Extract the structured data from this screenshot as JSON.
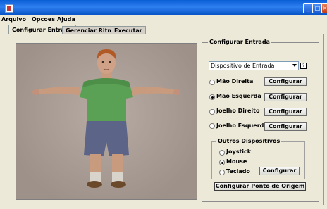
{
  "window": {
    "title": ""
  },
  "menu": [
    "Arquivo",
    "Opcoes",
    "Ajuda"
  ],
  "tabs": [
    "Configurar Entrada",
    "Gerenciar Ritmo",
    "Executar"
  ],
  "config": {
    "group_title": "Configurar Entrada",
    "device_select": "Dispositivo de Entrada",
    "help_label": "?",
    "options": [
      {
        "label": "Mão Direita",
        "selected": false,
        "button": "Configurar"
      },
      {
        "label": "Mão Esquerda",
        "selected": true,
        "button": "Configurar"
      },
      {
        "label": "Joelho Direito",
        "selected": false,
        "button": "Configurar"
      },
      {
        "label": "Joelho Esquerdo",
        "selected": false,
        "button": "Configurar"
      }
    ],
    "other_devices": {
      "title": "Outros Dispositivos",
      "items": [
        {
          "label": "Joystick",
          "selected": false
        },
        {
          "label": "Mouse",
          "selected": true
        },
        {
          "label": "Teclado",
          "selected": false,
          "button": "Configurar"
        }
      ]
    },
    "origin_button": "Configurar Ponto de Origem"
  },
  "colors": {
    "title_bar": "#2e7ff0",
    "window_bg": "#ece9d8",
    "viewport_bg": "#a89b93"
  }
}
